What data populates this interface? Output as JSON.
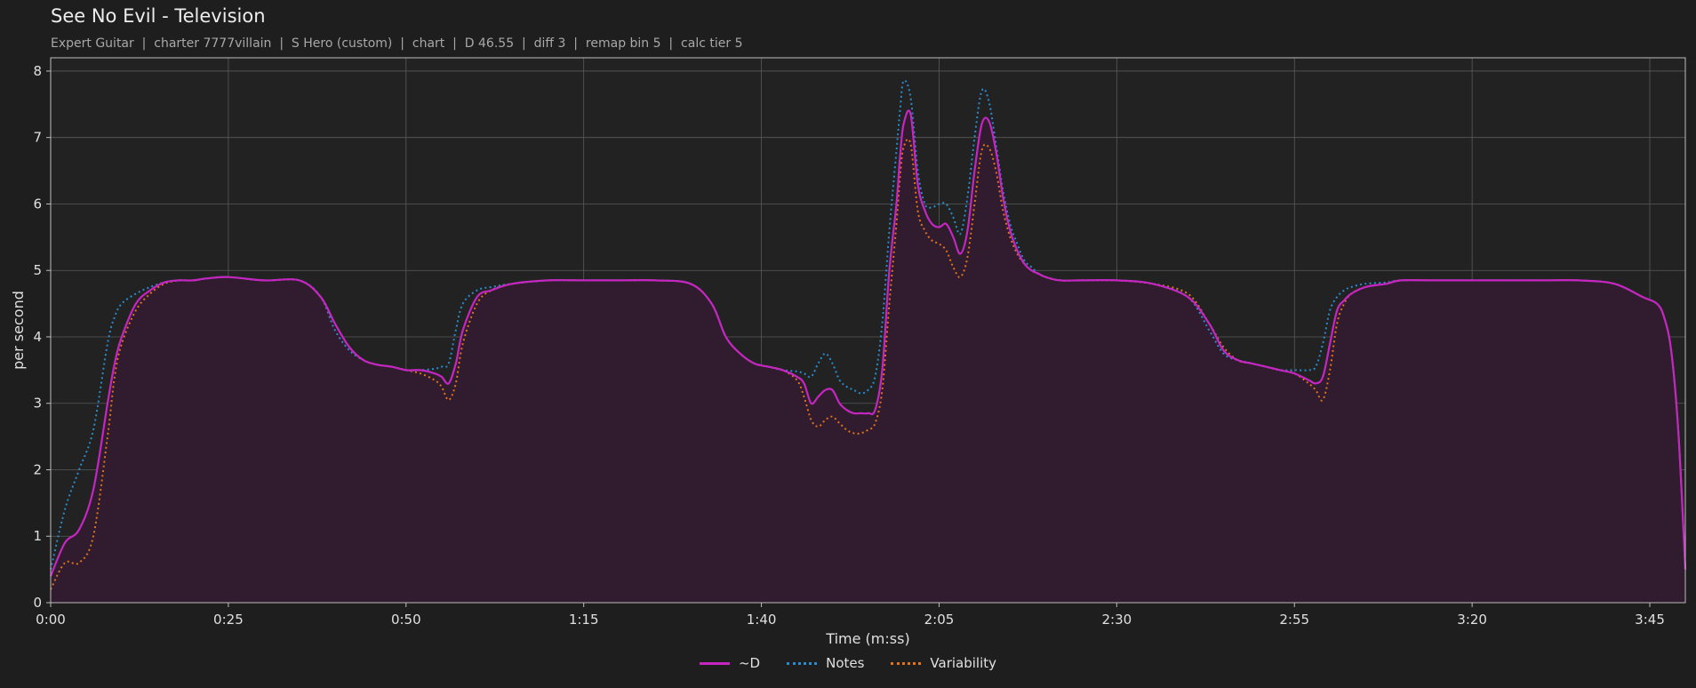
{
  "header": {
    "title": "See No Evil - Television",
    "subtitle": "Expert Guitar  |  charter 7777villain  |  S Hero (custom)  |  chart  |  D 46.55  |  diff 3  |  remap bin 5  |  calc tier 5"
  },
  "colors": {
    "background": "#1e1e1e",
    "plot_background": "#222222",
    "grid": "#5a5a5a",
    "area_fill": "#311b2e",
    "d": "#c526c2",
    "notes": "#2a8cd0",
    "variability": "#e0731c"
  },
  "chart_data": {
    "type": "line",
    "xlabel": "Time (m:ss)",
    "ylabel": "per second",
    "xlim": [
      0,
      230
    ],
    "ylim": [
      0,
      8.2
    ],
    "xticks": [
      0,
      25,
      50,
      75,
      100,
      125,
      150,
      175,
      200,
      225
    ],
    "xtick_labels": [
      "0:00",
      "0:25",
      "0:50",
      "1:15",
      "1:40",
      "2:05",
      "2:30",
      "2:55",
      "3:20",
      "3:45"
    ],
    "yticks": [
      0,
      1,
      2,
      3,
      4,
      5,
      6,
      7,
      8
    ],
    "grid": true,
    "legend_position": "bottom-center",
    "x": [
      0,
      2,
      4,
      6,
      8,
      9,
      10,
      12,
      14,
      16,
      18,
      20,
      22,
      25,
      30,
      35,
      38,
      40,
      42,
      44,
      46,
      48,
      50,
      52,
      54,
      55,
      56,
      57,
      58,
      60,
      62,
      65,
      70,
      75,
      80,
      85,
      90,
      93,
      95,
      97,
      99,
      101,
      103,
      105,
      106,
      107,
      108,
      109,
      110,
      111,
      112,
      113,
      114,
      115,
      116,
      117,
      118,
      119,
      119.5,
      120,
      121,
      122,
      123,
      124,
      125,
      126,
      127,
      128,
      129,
      130,
      131,
      132,
      133,
      134,
      135,
      136,
      137,
      138,
      139,
      140,
      142,
      145,
      150,
      155,
      160,
      163,
      165,
      167,
      169,
      171,
      173,
      175,
      177,
      178,
      179,
      180,
      181,
      182,
      183,
      185,
      188,
      190,
      195,
      200,
      205,
      210,
      215,
      220,
      224,
      226,
      227,
      228,
      229,
      230
    ],
    "series": [
      {
        "name": "~D",
        "style": "solid",
        "values": [
          0.4,
          0.9,
          1.1,
          1.7,
          3.0,
          3.6,
          4.0,
          4.5,
          4.7,
          4.82,
          4.85,
          4.85,
          4.88,
          4.9,
          4.85,
          4.85,
          4.6,
          4.2,
          3.85,
          3.65,
          3.58,
          3.55,
          3.5,
          3.5,
          3.45,
          3.4,
          3.3,
          3.6,
          4.1,
          4.6,
          4.7,
          4.8,
          4.85,
          4.85,
          4.85,
          4.85,
          4.8,
          4.5,
          4.0,
          3.75,
          3.6,
          3.55,
          3.5,
          3.4,
          3.3,
          3.0,
          3.1,
          3.2,
          3.2,
          3.0,
          2.9,
          2.85,
          2.85,
          2.85,
          2.9,
          3.5,
          5.0,
          6.0,
          6.7,
          7.2,
          7.35,
          6.3,
          5.9,
          5.7,
          5.65,
          5.7,
          5.5,
          5.25,
          5.6,
          6.5,
          7.2,
          7.25,
          6.8,
          6.1,
          5.6,
          5.3,
          5.1,
          5.0,
          4.95,
          4.9,
          4.85,
          4.85,
          4.85,
          4.8,
          4.6,
          4.2,
          3.8,
          3.65,
          3.6,
          3.55,
          3.5,
          3.45,
          3.35,
          3.3,
          3.4,
          3.9,
          4.4,
          4.55,
          4.65,
          4.75,
          4.8,
          4.85,
          4.85,
          4.85,
          4.85,
          4.85,
          4.85,
          4.8,
          4.6,
          4.5,
          4.3,
          3.8,
          2.6,
          0.5
        ]
      },
      {
        "name": "Notes",
        "style": "dotted",
        "values": [
          0.5,
          1.4,
          2.0,
          2.6,
          3.9,
          4.3,
          4.5,
          4.65,
          4.75,
          4.82,
          4.85,
          4.85,
          4.88,
          4.9,
          4.85,
          4.85,
          4.6,
          4.1,
          3.8,
          3.65,
          3.58,
          3.55,
          3.5,
          3.5,
          3.52,
          3.55,
          3.6,
          4.1,
          4.5,
          4.7,
          4.75,
          4.8,
          4.85,
          4.85,
          4.85,
          4.85,
          4.8,
          4.5,
          4.0,
          3.75,
          3.6,
          3.55,
          3.5,
          3.48,
          3.45,
          3.4,
          3.6,
          3.75,
          3.6,
          3.35,
          3.25,
          3.2,
          3.15,
          3.2,
          3.4,
          4.2,
          5.6,
          6.8,
          7.4,
          7.85,
          7.6,
          6.5,
          6.0,
          5.95,
          6.0,
          6.0,
          5.8,
          5.55,
          6.1,
          7.0,
          7.7,
          7.55,
          6.9,
          6.2,
          5.7,
          5.4,
          5.15,
          5.05,
          4.95,
          4.9,
          4.85,
          4.85,
          4.85,
          4.8,
          4.6,
          4.1,
          3.75,
          3.65,
          3.6,
          3.55,
          3.5,
          3.5,
          3.5,
          3.55,
          3.9,
          4.4,
          4.6,
          4.7,
          4.75,
          4.8,
          4.82,
          4.85,
          4.85,
          4.85,
          4.85,
          4.85,
          4.85,
          4.8,
          4.6,
          4.5,
          4.3,
          3.8,
          2.6,
          0.5
        ]
      },
      {
        "name": "Variability",
        "style": "dotted",
        "values": [
          0.2,
          0.6,
          0.6,
          1.0,
          2.5,
          3.4,
          3.9,
          4.4,
          4.65,
          4.8,
          4.85,
          4.85,
          4.88,
          4.9,
          4.85,
          4.85,
          4.6,
          4.2,
          3.85,
          3.65,
          3.58,
          3.55,
          3.5,
          3.45,
          3.35,
          3.25,
          3.05,
          3.3,
          3.9,
          4.5,
          4.7,
          4.8,
          4.85,
          4.85,
          4.85,
          4.85,
          4.8,
          4.5,
          4.0,
          3.75,
          3.6,
          3.55,
          3.5,
          3.35,
          3.1,
          2.75,
          2.65,
          2.75,
          2.8,
          2.7,
          2.6,
          2.55,
          2.55,
          2.6,
          2.7,
          3.2,
          4.5,
          5.7,
          6.4,
          6.85,
          6.9,
          5.9,
          5.6,
          5.45,
          5.4,
          5.3,
          5.05,
          4.9,
          5.2,
          6.0,
          6.8,
          6.85,
          6.5,
          5.9,
          5.5,
          5.25,
          5.1,
          5.0,
          4.95,
          4.9,
          4.85,
          4.85,
          4.85,
          4.8,
          4.65,
          4.2,
          3.85,
          3.65,
          3.6,
          3.55,
          3.5,
          3.45,
          3.3,
          3.2,
          3.05,
          3.5,
          4.2,
          4.5,
          4.65,
          4.75,
          4.8,
          4.85,
          4.85,
          4.85,
          4.85,
          4.85,
          4.85,
          4.8,
          4.6,
          4.5,
          4.3,
          3.8,
          2.6,
          0.5
        ]
      }
    ]
  }
}
